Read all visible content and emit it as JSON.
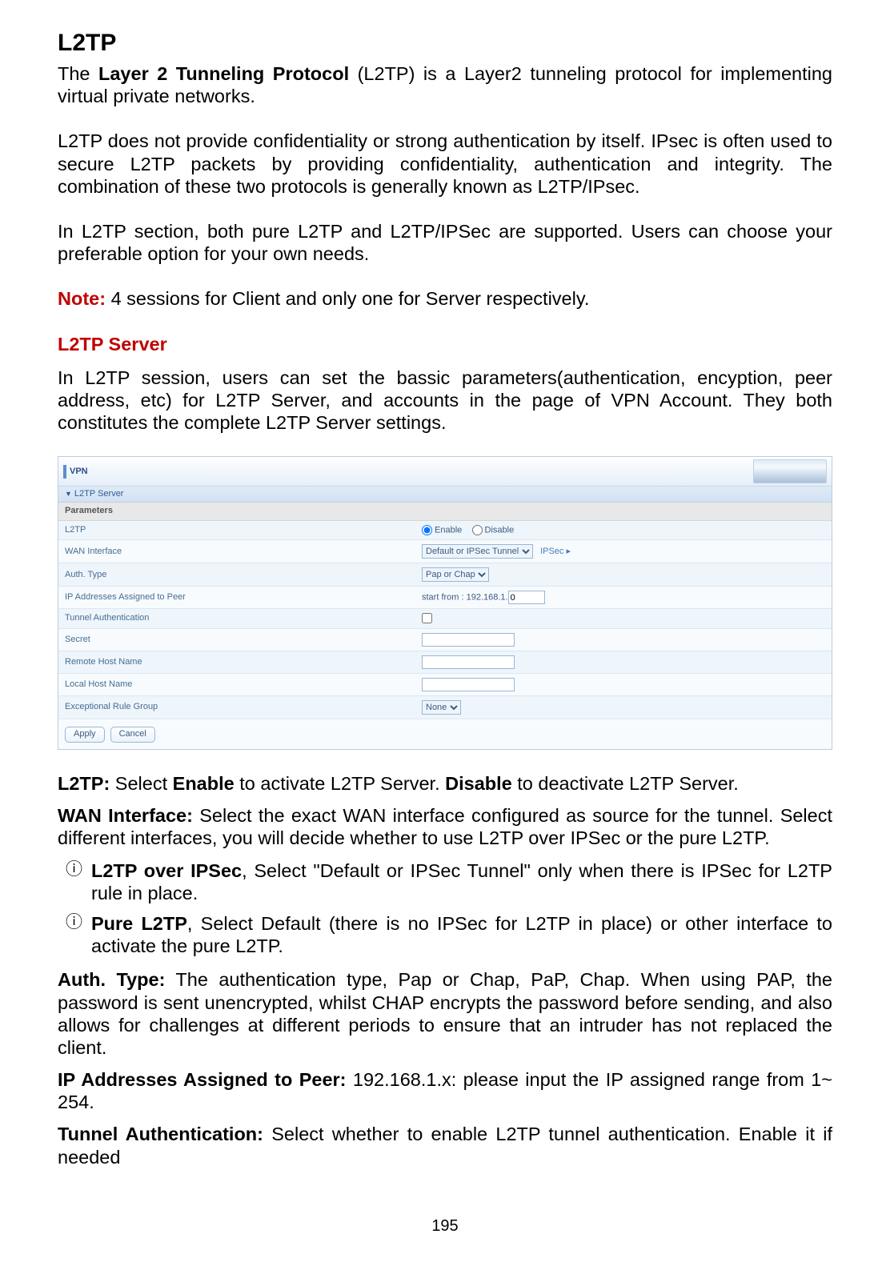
{
  "title": "L2TP",
  "intro": {
    "pre": "The ",
    "bold": "Layer 2 Tunneling Protocol",
    "post": " (L2TP) is a Layer2 tunneling protocol for implementing virtual private networks."
  },
  "para2": "L2TP does not provide confidentiality or strong authentication by itself. IPsec is often used to secure L2TP packets by providing confidentiality, authentication and integrity. The combination of these two protocols is generally known as L2TP/IPsec.",
  "para3": "In L2TP section, both pure L2TP and L2TP/IPSec are supported. Users can choose your preferable option for your own needs.",
  "note_label": "Note:",
  "note_text": " 4 sessions for Client and only one for Server respectively.",
  "subhead": "L2TP Server",
  "para4": "In L2TP session, users can set the bassic parameters(authentication, encyption, peer address, etc) for L2TP Server, and accounts in the page of VPN Account. They both constitutes the complete L2TP Server settings.",
  "shot": {
    "vpn": "VPN",
    "section": "L2TP Server",
    "parameters": "Parameters",
    "rows": {
      "l2tp": "L2TP",
      "enable": "Enable",
      "disable": "Disable",
      "wan": "WAN Interface",
      "wan_val": "Default or IPSec Tunnel",
      "ipsec_link": "IPSec ▸",
      "auth": "Auth. Type",
      "auth_val": "Pap or Chap",
      "ipassign": "IP Addresses Assigned to Peer",
      "startfrom": "start from : 192.168.1.",
      "startfrom_val": "0",
      "tunnel": "Tunnel Authentication",
      "secret": "Secret",
      "remote": "Remote Host Name",
      "local": "Local Host Name",
      "except": "Exceptional Rule Group",
      "except_val": "None"
    },
    "apply": "Apply",
    "cancel": "Cancel"
  },
  "desc": {
    "l2tp_label": "L2TP:",
    "l2tp1": " Select ",
    "l2tp_enable": "Enable",
    "l2tp2": " to activate L2TP Server. ",
    "l2tp_disable": "Disable",
    "l2tp3": " to deactivate L2TP Server.",
    "wan_label": "WAN Interface:",
    "wan_text": " Select the exact WAN interface configured as source for the tunnel. Select different interfaces, you will decide whether to use L2TP over IPSec or the pure L2TP.",
    "li1_label": "L2TP over IPSec",
    "li1_text": ", Select \"Default or IPSec Tunnel\" only when there is IPSec for L2TP rule in place.",
    "li2_label": "Pure L2TP",
    "li2_text": ", Select Default (there is no IPSec for L2TP in place) or other interface to activate the pure L2TP.",
    "auth_label": "Auth. Type:",
    "auth_text": " The authentication type, Pap or Chap, PaP, Chap. When using PAP, the password is sent unencrypted, whilst CHAP encrypts the password before sending, and also allows for challenges at different periods to ensure that an intruder has not replaced the client.",
    "ip_label": "IP Addresses Assigned to Peer:",
    "ip_text": " 192.168.1.x: please input the IP assigned range from 1~ 254.",
    "tunnel_label": "Tunnel Authentication:",
    "tunnel_text": " Select whether to enable L2TP tunnel authentication. Enable it if needed"
  },
  "page_number": "195"
}
